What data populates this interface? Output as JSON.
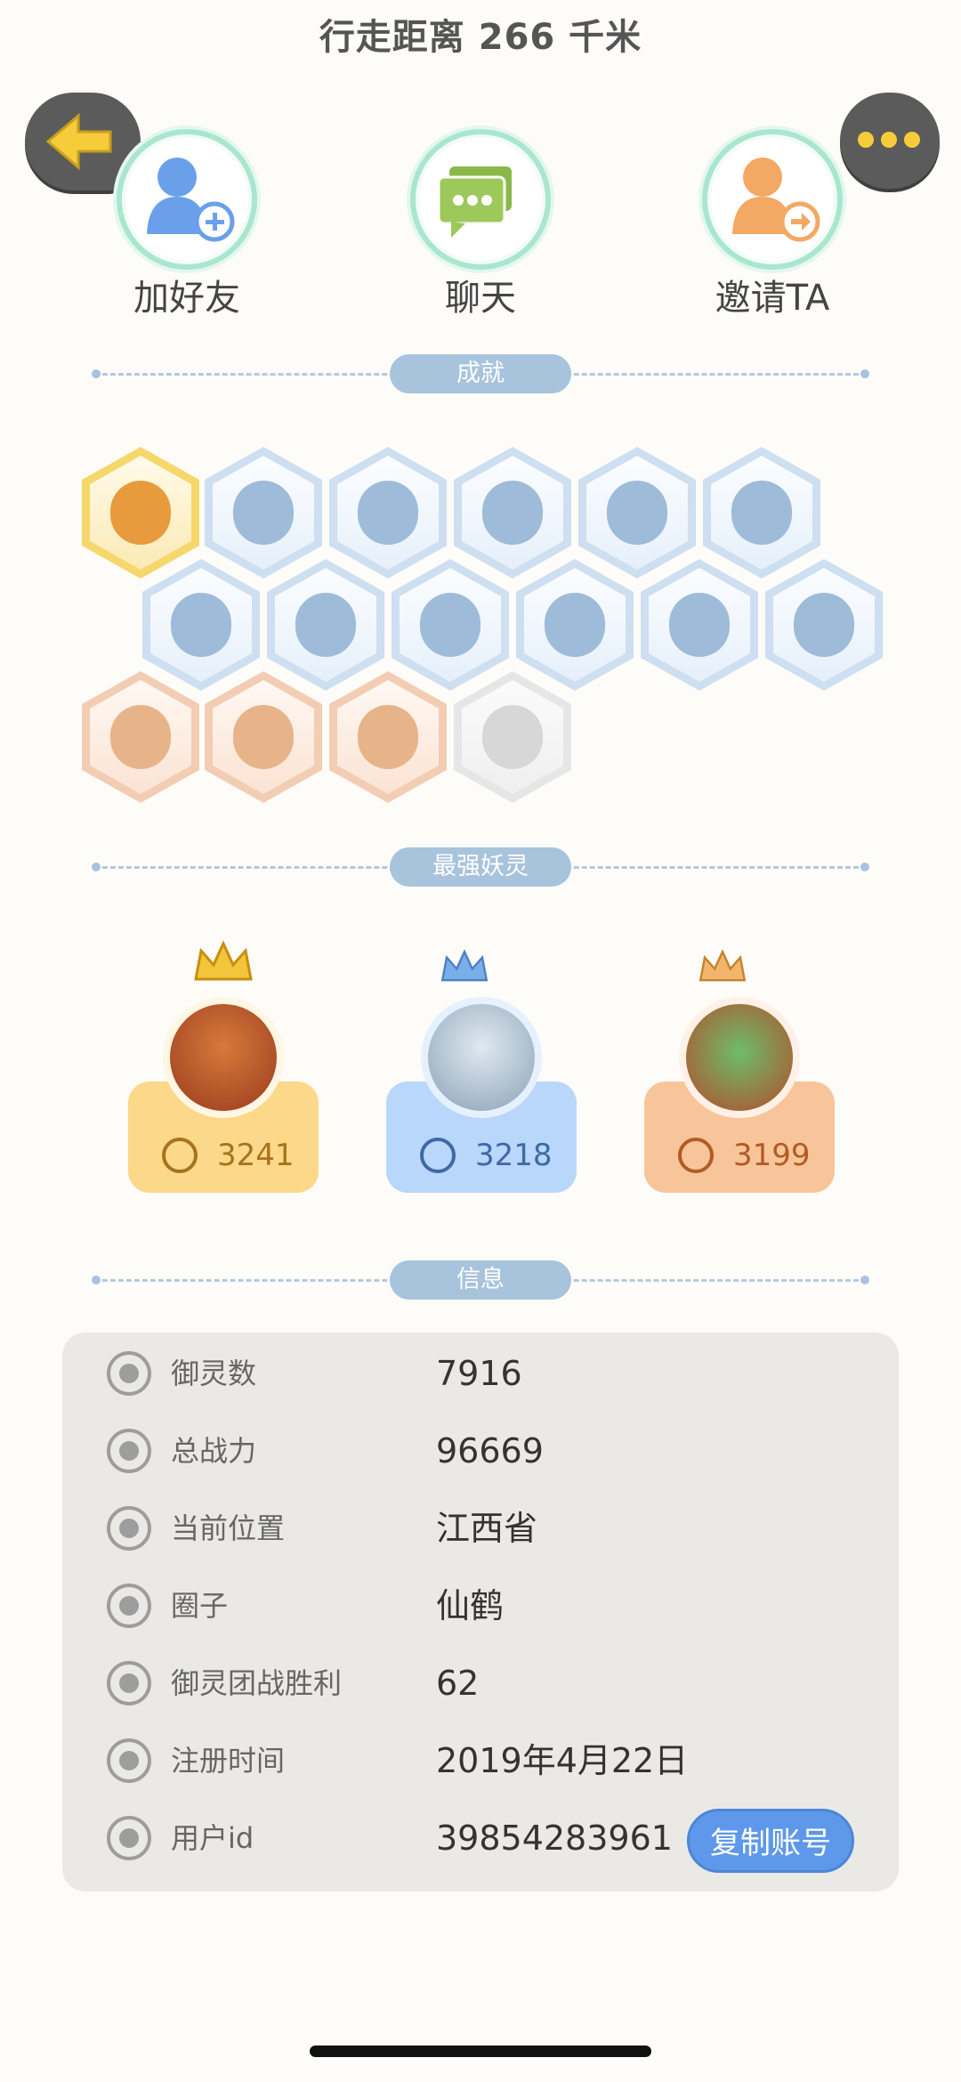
{
  "header": {
    "title": "行走距离 266 千米"
  },
  "actions": [
    {
      "label": "加好友",
      "icon": "add-friend-icon"
    },
    {
      "label": "聊天",
      "icon": "chat-icon"
    },
    {
      "label": "邀请TA",
      "icon": "invite-icon"
    }
  ],
  "sections": {
    "achievements": "成就",
    "strongest": "最强妖灵",
    "info": "信息"
  },
  "strongest": [
    {
      "power": "3241",
      "color": "#fbd88a"
    },
    {
      "power": "3218",
      "color": "#b9d7fb"
    },
    {
      "power": "3199",
      "color": "#f8c59a"
    }
  ],
  "info": {
    "rows": [
      {
        "label": "御灵数",
        "value": "7916",
        "icon": "spirit-icon"
      },
      {
        "label": "总战力",
        "value": "96669",
        "icon": "sword-icon"
      },
      {
        "label": "当前位置",
        "value": "江西省",
        "icon": "location-pin-icon"
      },
      {
        "label": "圈子",
        "value": "仙鹤",
        "icon": "circle-icon"
      },
      {
        "label": "御灵团战胜利",
        "value": "62",
        "icon": "team-battle-icon"
      },
      {
        "label": "注册时间",
        "value": "2019年4月22日",
        "icon": "clock-icon"
      },
      {
        "label": "用户id",
        "value": "39854283961",
        "icon": "id-card-icon"
      }
    ],
    "copy_button": "复制账号"
  }
}
